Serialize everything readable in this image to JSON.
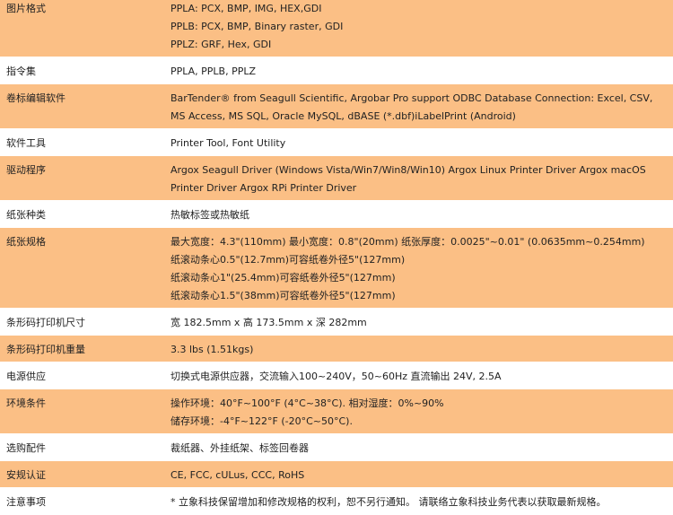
{
  "rows": [
    {
      "label": "图片格式",
      "lines": [
        "PPLA: PCX, BMP, IMG, HEX,GDI",
        "PPLB: PCX, BMP, Binary raster, GDI",
        "PPLZ: GRF, Hex, GDI"
      ]
    },
    {
      "label": "指令集",
      "lines": [
        "PPLA, PPLB, PPLZ"
      ]
    },
    {
      "label": "卷标编辑软件",
      "lines": [
        "BarTender® from Seagull Scientific, Argobar Pro support ODBC Database Connection: Excel, CSV, MS Access, MS SQL, Oracle MySQL, dBASE (*.dbf)iLabelPrint (Android)"
      ]
    },
    {
      "label": "软件工具",
      "lines": [
        "Printer Tool, Font Utility"
      ]
    },
    {
      "label": "驱动程序",
      "lines": [
        "Argox Seagull Driver (Windows Vista/Win7/Win8/Win10) Argox Linux Printer Driver Argox macOS Printer Driver Argox RPi Printer Driver"
      ]
    },
    {
      "label": "纸张种类",
      "lines": [
        "热敏标签或热敏纸"
      ]
    },
    {
      "label": "纸张规格",
      "lines": [
        "最大宽度：4.3\"(110mm) 最小宽度：0.8\"(20mm) 纸张厚度：0.0025\"~0.01\" (0.0635mm~0.254mm)",
        "纸滚动条心0.5\"(12.7mm)可容纸卷外径5\"(127mm)",
        "纸滚动条心1\"(25.4mm)可容纸卷外径5\"(127mm)",
        "纸滚动条心1.5\"(38mm)可容纸卷外径5\"(127mm)"
      ]
    },
    {
      "label": "条形码打印机尺寸",
      "lines": [
        "宽 182.5mm x 高 173.5mm x 深 282mm"
      ]
    },
    {
      "label": "条形码打印机重量",
      "lines": [
        "3.3 lbs (1.51kgs)"
      ]
    },
    {
      "label": "电源供应",
      "lines": [
        "切换式电源供应器，交流输入100~240V，50~60Hz 直流输出 24V, 2.5A"
      ]
    },
    {
      "label": "环境条件",
      "lines": [
        "操作环境：40°F~100°F (4°C~38°C). 相对湿度：0%~90%",
        "储存环境：-4°F~122°F (-20°C~50°C)."
      ]
    },
    {
      "label": "选购配件",
      "lines": [
        "裁纸器、外挂纸架、标签回卷器"
      ]
    },
    {
      "label": "安规认证",
      "lines": [
        "CE, FCC, cULus, CCC, RoHS"
      ]
    },
    {
      "label": "注意事项",
      "lines": [
        "* 立象科技保留增加和修改规格的权利，恕不另行通知。 请联络立象科技业务代表以获取最新规格。"
      ]
    }
  ]
}
